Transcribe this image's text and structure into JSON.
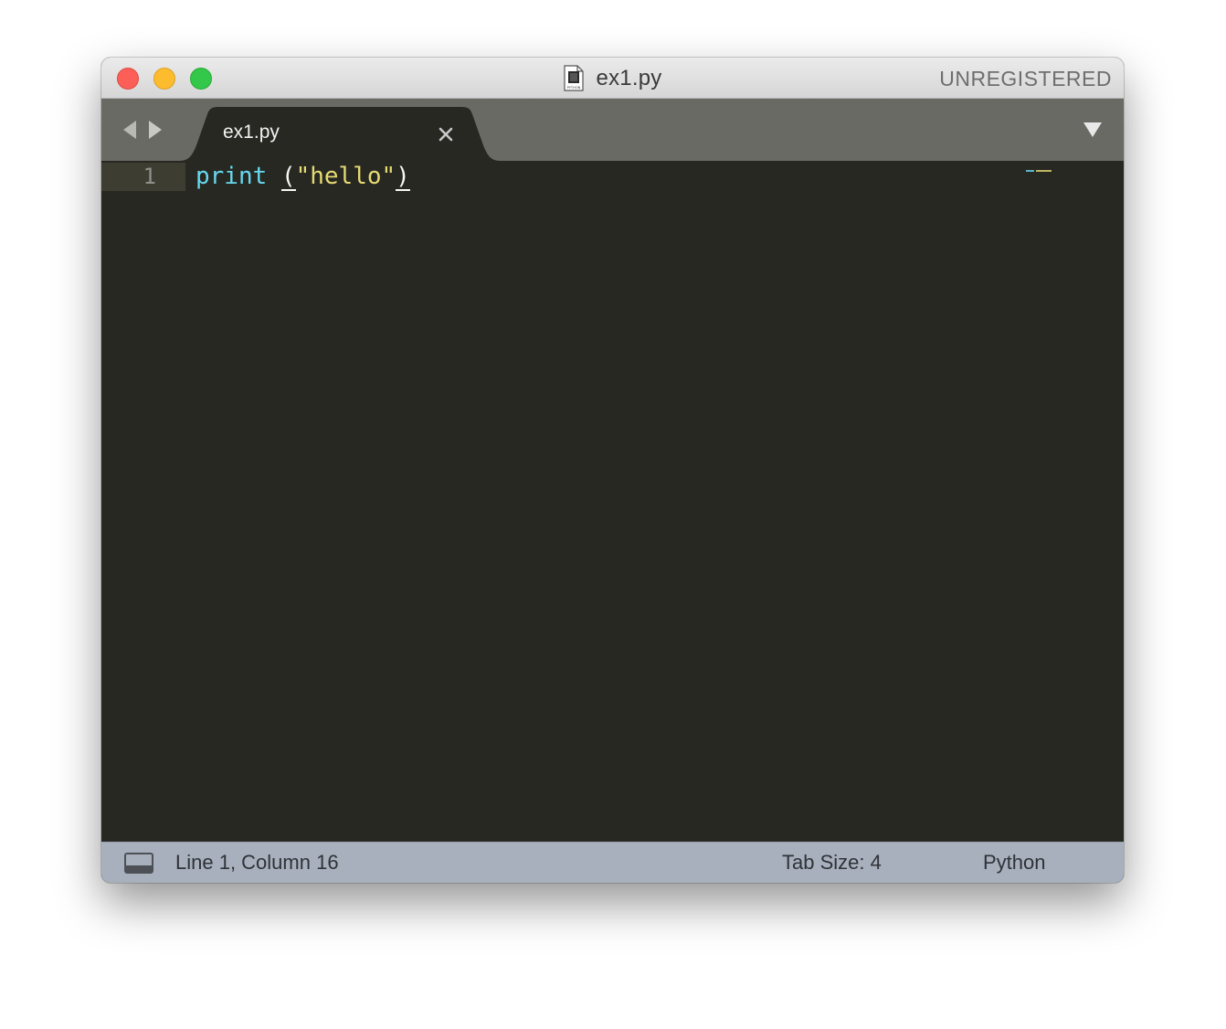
{
  "window": {
    "title": "ex1.py",
    "file_icon_label": "PYTHON",
    "registration_status": "UNREGISTERED"
  },
  "tabs": [
    {
      "label": "ex1.py",
      "active": true
    }
  ],
  "icons": {
    "close": "close-icon",
    "back": "arrow-left-icon",
    "forward": "arrow-right-icon",
    "tab_close": "x-icon",
    "tab_list": "triangle-down-icon",
    "panel": "panel-toggle-icon"
  },
  "editor": {
    "lines": [
      {
        "number": "1",
        "tokens": [
          {
            "text": "print",
            "kind": "builtin"
          },
          {
            "text": " ",
            "kind": "plain"
          },
          {
            "text": "(",
            "kind": "paren"
          },
          {
            "text": "\"hello\"",
            "kind": "string"
          },
          {
            "text": ")",
            "kind": "paren"
          }
        ]
      }
    ]
  },
  "status": {
    "position": "Line 1, Column 16",
    "tab_size": "Tab Size: 4",
    "syntax": "Python"
  },
  "colors": {
    "editor_bg": "#272822",
    "builtin": "#66d9ef",
    "string": "#e6db74",
    "plain": "#f8f8f2",
    "tabbar_bg": "#6a6a64",
    "statusbar_bg": "#a8b0bd"
  }
}
